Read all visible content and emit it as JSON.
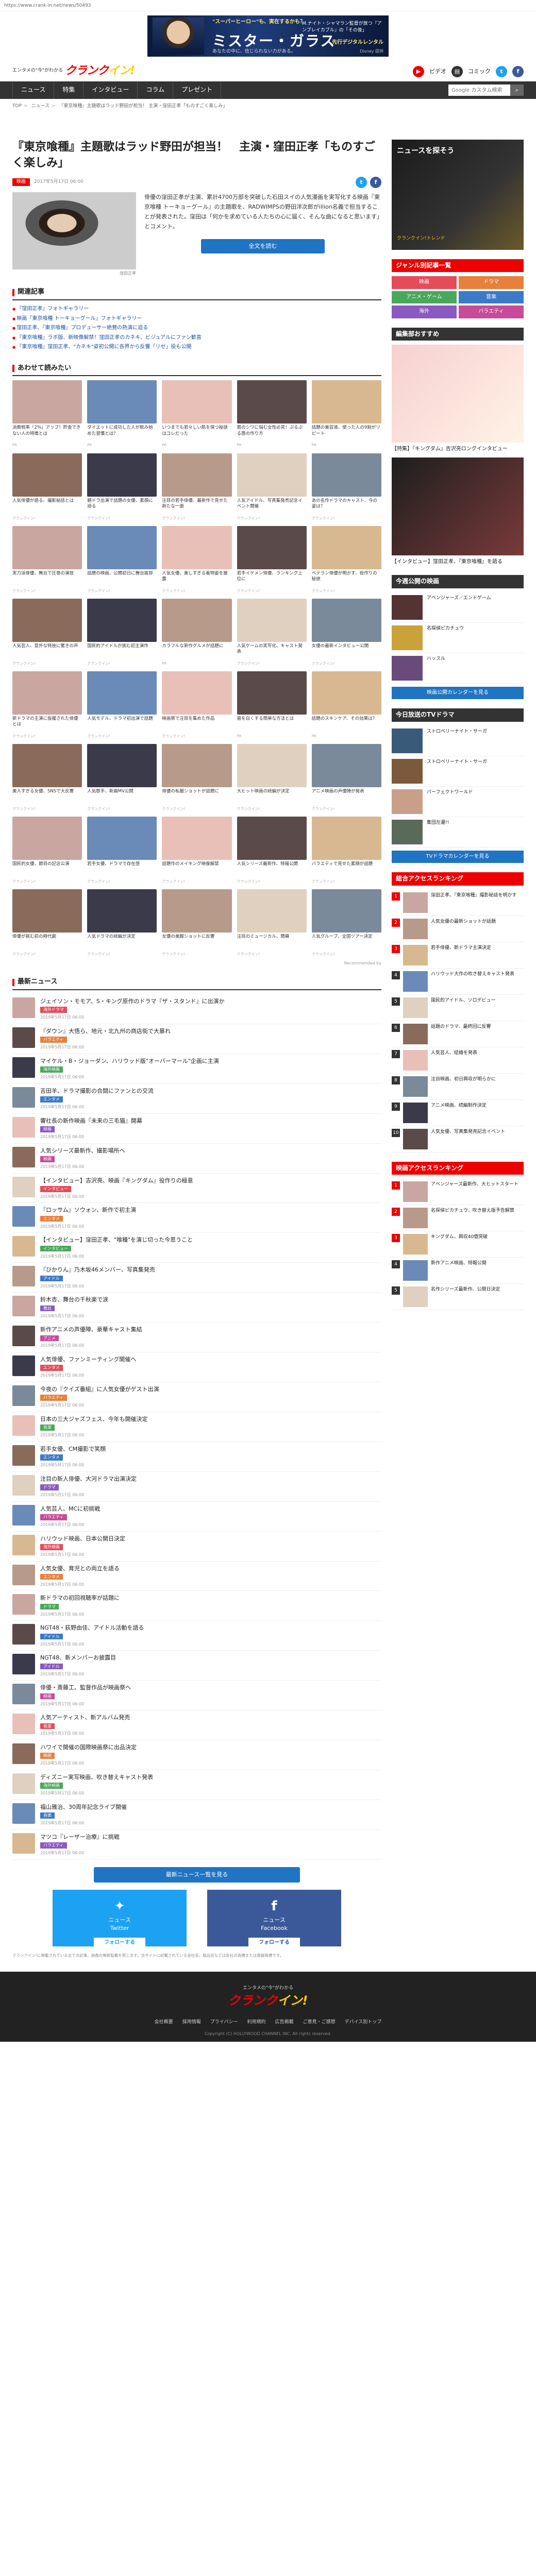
{
  "url": "https://www.crank-in.net/news/50493",
  "top_ad": {
    "catch": "\"スーパーヒーロー\"も、実在するかも？",
    "headline": "ミスター・ガラス",
    "sub": "M.ナイト・シャマラン監督が放つ『アンブレイカブル』の「その後」",
    "release": "先行デジタルレンタル",
    "note": "Disney 提供",
    "small": "あなたの中に、信じられない力がある。"
  },
  "header": {
    "tagline": "エンタメの\"今\"がわかる",
    "logo_main": "クランク",
    "logo_mark": "イン!",
    "links": [
      "ビデオ",
      "コミック"
    ]
  },
  "nav": {
    "items": [
      "ニュース",
      "特集",
      "インタビュー",
      "コラム",
      "プレゼント"
    ],
    "search_placeholder": "Google カスタム検索"
  },
  "breadcrumb": [
    "TOP",
    "ニュース",
    "『東京喰種』主題歌はラッド野田が担当！ 主演・窪田正孝「ものすごく楽しみ」"
  ],
  "article": {
    "title": "『東京喰種』主題歌はラッド野田が担当！　主演・窪田正孝「ものすごく楽しみ」",
    "category": "映画",
    "date": "2017年5月17日 06:00",
    "photo_caption": "窪田正孝",
    "lead": "俳優の窪田正孝が主演、累計4700万部を突破した石田スイの人気漫画を実写化する映画『東京喰種 トーキョーグール』の主題歌を、RADWIMPSの野田洋次郎がillion名義で担当することが発表された。窪田は「何かを求めている人たちの心に届く、そんな曲になると思います」とコメント。",
    "more_label": "全文を読む"
  },
  "related": {
    "heading": "関連記事",
    "items": [
      "『窪田正孝』フォトギャラリー",
      "映画『東京喰種 トーキョーグール』フォトギャラリー",
      "窪田正孝、『東京喰種』プロデューサー絶賛の熱演に迫る",
      "『東京喰種』ラボ版、新映像解禁！窪田正孝のカネキ、ビジュアルにファン歓喜",
      "『東京喰種』窪田正孝、\"カネキ\"姿初公開に各界から反響「リゼ」役も公開"
    ]
  },
  "recommend": {
    "heading": "あわせて読みたい",
    "items": [
      {
        "cap": "消費税率「2%」アップ！貯金できない人の特徴とは",
        "sp": "PR"
      },
      {
        "cap": "ダイエットに成功した人が飲み始めた習慣とは？",
        "sp": "PR"
      },
      {
        "cap": "いつまでも若々しい肌を保つ秘訣はコレだった",
        "sp": "PR"
      },
      {
        "cap": "唇のシワに悩む女性必見！ぷるぷる唇の作り方",
        "sp": "PR"
      },
      {
        "cap": "話題の美容液、使った人の9割がリピート",
        "sp": "PR"
      },
      {
        "cap": "人気俳優が語る、撮影秘話とは",
        "sp": "クランクイン!"
      },
      {
        "cap": "朝ドラ出演で話題の女優、素顔に迫る",
        "sp": "クランクイン!"
      },
      {
        "cap": "注目の若手俳優、最新作で見せた新たな一面",
        "sp": "クランクイン!"
      },
      {
        "cap": "人気アイドル、写真集発売記念イベント開催",
        "sp": "クランクイン!"
      },
      {
        "cap": "あの名作ドラマのキャスト、今の姿は？",
        "sp": "クランクイン!"
      },
      {
        "cap": "実力派俳優、舞台で圧巻の演技",
        "sp": "クランクイン!"
      },
      {
        "cap": "話題の映画、公開初日に舞台挨拶",
        "sp": "クランクイン!"
      },
      {
        "cap": "人気女優、美しすぎる着物姿を披露",
        "sp": "クランクイン!"
      },
      {
        "cap": "若手イケメン俳優、ランキング上位に",
        "sp": "クランクイン!"
      },
      {
        "cap": "ベテラン俳優が明かす、役作りの秘訣",
        "sp": "クランクイン!"
      },
      {
        "cap": "人気芸人、意外な特技に驚きの声",
        "sp": "クランクイン!"
      },
      {
        "cap": "国民的アイドルが挑む初主演作",
        "sp": "クランクイン!"
      },
      {
        "cap": "カラフルな新作グルメが話題に",
        "sp": "PR"
      },
      {
        "cap": "人気ゲームの実写化、キャスト発表",
        "sp": "クランクイン!"
      },
      {
        "cap": "女優の最新インタビュー公開",
        "sp": "クランクイン!"
      },
      {
        "cap": "新ドラマの主演に抜擢された俳優とは",
        "sp": "クランクイン!"
      },
      {
        "cap": "人気モデル、ドラマ初出演で話題",
        "sp": "クランクイン!"
      },
      {
        "cap": "映画祭で注目を集めた作品",
        "sp": "クランクイン!"
      },
      {
        "cap": "歯を白くする簡単な方法とは",
        "sp": "PR"
      },
      {
        "cap": "話題のスキンケア、その効果は？",
        "sp": "PR"
      },
      {
        "cap": "美人すぎる女優、SNSで大反響",
        "sp": "クランクイン!"
      },
      {
        "cap": "人気歌手、新曲MV公開",
        "sp": "クランクイン!"
      },
      {
        "cap": "俳優の私服ショットが話題に",
        "sp": "クランクイン!"
      },
      {
        "cap": "大ヒット映画の続編が決定",
        "sp": "クランクイン!"
      },
      {
        "cap": "アニメ映画の声優陣が発表",
        "sp": "クランクイン!"
      },
      {
        "cap": "国民的女優、節目の記念公演",
        "sp": "クランクイン!"
      },
      {
        "cap": "若手女優、ドラマで存在感",
        "sp": "クランクイン!"
      },
      {
        "cap": "話題作のメイキング映像解禁",
        "sp": "クランクイン!"
      },
      {
        "cap": "人気シリーズ最新作、特報公開",
        "sp": "クランクイン!"
      },
      {
        "cap": "バラエティで見せた素顔が話題",
        "sp": "クランクイン!"
      },
      {
        "cap": "俳優が挑む初の時代劇",
        "sp": "クランクイン!"
      },
      {
        "cap": "人気ドラマの続編が決定",
        "sp": "クランクイン!"
      },
      {
        "cap": "女優の美脚ショットに反響",
        "sp": "クランクイン!"
      },
      {
        "cap": "注目のミュージカル、開幕",
        "sp": "クランクイン!"
      },
      {
        "cap": "人気グループ、全国ツアー決定",
        "sp": "クランクイン!"
      }
    ],
    "powered": "Recommended by"
  },
  "latest": {
    "heading": "最新ニュース",
    "items": [
      {
        "t": "ジェイソン・モモア、S・キング原作のドラマ『ザ・スタンド』に出演か",
        "d": "2019年5月17日 06:00",
        "tag": "海外ドラマ"
      },
      {
        "t": "『ダウン』大悟ら、地元・北九州の商店街で大暴れ",
        "d": "2019年5月17日 06:00",
        "tag": "バラエティ"
      },
      {
        "t": "マイケル・B・ジョーダン、ハリウッド版\"オーバーマール\"企画に主演",
        "d": "2019年5月17日 06:00",
        "tag": "海外映画"
      },
      {
        "t": "吉田羊、ドラマ撮影の合間にファンとの交流",
        "d": "2019年5月17日 06:00",
        "tag": "エンタメ"
      },
      {
        "t": "響社長の新作映画『未来の三毛猫』開幕",
        "d": "2019年5月17日 06:00",
        "tag": "映画"
      },
      {
        "t": "人気シリーズ最新作、撮影場所へ",
        "d": "2019年5月17日 06:00",
        "tag": "映画"
      },
      {
        "t": "【インタビュー】吉沢亮、映画『キングダム』役作りの極意",
        "d": "2019年5月17日 06:00",
        "tag": "インタビュー"
      },
      {
        "t": "『ロッサム』ソウォン、新作で初主演",
        "d": "2019年5月17日 06:00",
        "tag": "エンタメ"
      },
      {
        "t": "【インタビュー】窪田正孝、\"喰種\"を演じ切った今思うこと",
        "d": "2019年5月17日 06:00",
        "tag": "インタビュー"
      },
      {
        "t": "『ひかりん』乃木坂46メンバー、写真集発売",
        "d": "2019年5月17日 06:00",
        "tag": "アイドル"
      },
      {
        "t": "鈴木杏、舞台の千秋楽で涙",
        "d": "2019年5月17日 06:00",
        "tag": "舞台"
      },
      {
        "t": "新作アニメの声優陣、豪華キャスト集結",
        "d": "2019年5月17日 06:00",
        "tag": "アニメ"
      },
      {
        "t": "人気俳優、ファンミーティング開催へ",
        "d": "2019年5月17日 06:00",
        "tag": "エンタメ"
      },
      {
        "t": "今夜の『クイズ番組』に人気女優がゲスト出演",
        "d": "2019年5月17日 06:00",
        "tag": "バラエティ"
      },
      {
        "t": "日本の三大ジャズフェス、今年も開催決定",
        "d": "2019年5月17日 06:00",
        "tag": "音楽"
      },
      {
        "t": "若手女優、CM撮影で笑顔",
        "d": "2019年5月17日 06:00",
        "tag": "エンタメ"
      },
      {
        "t": "注目の新人俳優、大河ドラマ出演決定",
        "d": "2019年5月17日 06:00",
        "tag": "ドラマ"
      },
      {
        "t": "人気芸人、MCに初挑戦",
        "d": "2019年5月17日 06:00",
        "tag": "バラエティ"
      },
      {
        "t": "ハリウッド映画、日本公開日決定",
        "d": "2019年5月17日 06:00",
        "tag": "海外映画"
      },
      {
        "t": "人気女優、育児との両立を語る",
        "d": "2019年5月17日 06:00",
        "tag": "エンタメ"
      },
      {
        "t": "新ドラマの初回視聴率が話題に",
        "d": "2019年5月17日 06:00",
        "tag": "ドラマ"
      },
      {
        "t": "NGT48・荻野由佳、アイドル活動を語る",
        "d": "2019年5月17日 06:00",
        "tag": "アイドル"
      },
      {
        "t": "NGT48、新メンバーお披露目",
        "d": "2019年5月17日 06:00",
        "tag": "アイドル"
      },
      {
        "t": "俳優・斎藤工、監督作品が映画祭へ",
        "d": "2019年5月17日 06:00",
        "tag": "映画"
      },
      {
        "t": "人気アーティスト、新アルバム発売",
        "d": "2019年5月17日 06:00",
        "tag": "音楽"
      },
      {
        "t": "ハワイで開催の国際映画祭に出品決定",
        "d": "2019年5月17日 06:00",
        "tag": "映画"
      },
      {
        "t": "ディズニー実写映画、吹き替えキャスト発表",
        "d": "2019年5月17日 06:00",
        "tag": "海外映画"
      },
      {
        "t": "福山雅治、30周年記念ライブ開催",
        "d": "2019年5月17日 06:00",
        "tag": "音楽"
      },
      {
        "t": "マツコ『レーザー治療』に挑戦",
        "d": "2019年5月17日 06:00",
        "tag": "バラエティ"
      }
    ],
    "more_label": "最新ニュース一覧を見る"
  },
  "follow": {
    "twitter_title": "ニュース",
    "twitter_sub": "Twitter",
    "twitter_btn": "フォローする",
    "facebook_title": "ニュース",
    "facebook_sub": "Facebook",
    "facebook_btn": "フォローする"
  },
  "disclaimer": "クランクイン!に掲載されている全ての記事、画像の無断転載を禁じます。当サイトに記載されている会社名、製品名などは各社の商標または登録商標です。",
  "footer": {
    "tagline": "エンタメの\"今\"がわかる",
    "logo_main": "クランク",
    "logo_mark": "イン!",
    "links": [
      "会社概要",
      "採用情報",
      "プライバシー",
      "利用規約",
      "広告掲載",
      "ご意見・ご感想",
      "デバイス別トップ"
    ],
    "copyright": "Copyright (C) HOLLYWOOD CHANNEL INC. All rights reserved."
  },
  "side": {
    "ad_title": "ニュースを探そう",
    "ad_sub": "クランクイン!トレンド",
    "genre_heading": "ジャンル別記事一覧",
    "genres": [
      "映画",
      "ドラマ",
      "アニメ・ゲーム",
      "音楽",
      "海外",
      "バラエティ"
    ],
    "recommend_heading": "編集部おすすめ",
    "recommend_items": [
      {
        "t": "【特集】『キングダム』吉沢亮ロングインタビュー"
      },
      {
        "t": "【インタビュー】窪田正孝、『東京喰種』を語る"
      }
    ],
    "program_heading": "今週公開の映画",
    "programs": [
      {
        "t": "アベンジャーズ／エンドゲーム"
      },
      {
        "t": "名探偵ピカチュウ"
      },
      {
        "t": "ハッスル"
      }
    ],
    "program_more": "映画公開カレンダーを見る",
    "tv_heading": "今日放送のTVドラマ",
    "tv_items": [
      {
        "t": "ストロベリーナイト・サーガ"
      },
      {
        "t": "ストロベリーナイト・サーガ"
      },
      {
        "t": "パーフェクトワールド"
      },
      {
        "t": "集団左遷!!"
      }
    ],
    "tv_more": "TVドラマカレンダーを見る",
    "rank_heading": "総合アクセスランキング",
    "rank_items": [
      {
        "t": "窪田正孝、『東京喰種』撮影秘話を明かす"
      },
      {
        "t": "人気女優の最新ショットが話題"
      },
      {
        "t": "若手俳優、新ドラマ主演決定"
      },
      {
        "t": "ハリウッド大作の吹き替えキャスト発表"
      },
      {
        "t": "国民的アイドル、ソロデビュー"
      },
      {
        "t": "話題のドラマ、最終回に反響"
      },
      {
        "t": "人気芸人、結婚を発表"
      },
      {
        "t": "注目映画、初日興収が明らかに"
      },
      {
        "t": "アニメ映画、続編制作決定"
      },
      {
        "t": "人気女優、写真集発売記念イベント"
      }
    ],
    "rank2_heading": "映画アクセスランキング",
    "rank2_items": [
      {
        "t": "アベンジャーズ最新作、大ヒットスタート"
      },
      {
        "t": "名探偵ピカチュウ、吹き替え版予告解禁"
      },
      {
        "t": "キングダム、興収40億突破"
      },
      {
        "t": "新作アニメ映画、特報公開"
      },
      {
        "t": "名作シリーズ最新作、公開日決定"
      }
    ]
  }
}
